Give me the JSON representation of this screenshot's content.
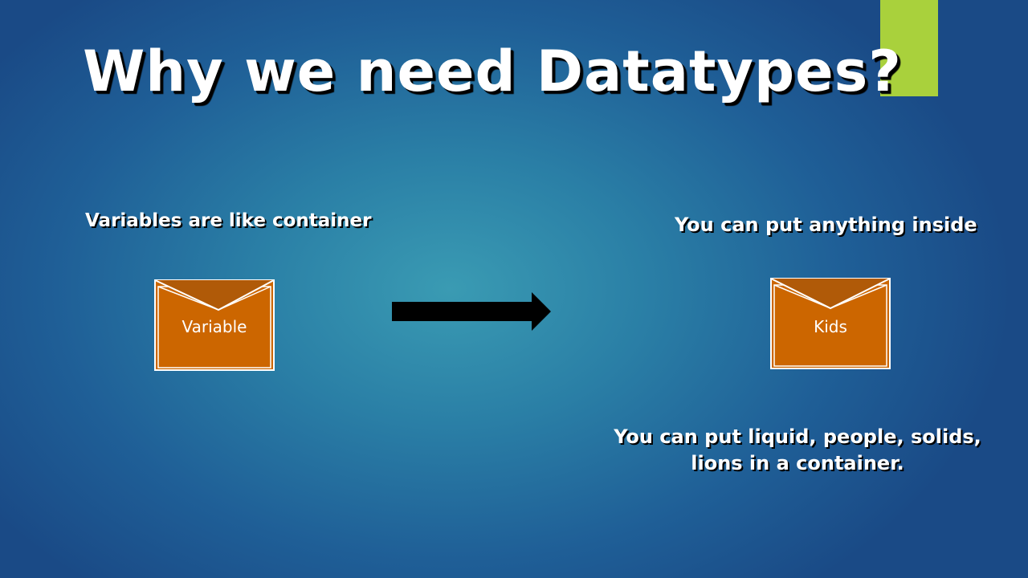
{
  "slide": {
    "title": "Why we need Datatypes?",
    "left_caption": "Variables are like container",
    "right_caption": "You can put anything inside",
    "bottom_caption": "You can put liquid, people, solids, lions in a container.",
    "left_envelope_label": "Variable",
    "right_envelope_label": "Kids"
  },
  "colors": {
    "accent": "#a9d13c",
    "envelope_fill": "#cc6600",
    "envelope_flap": "#b05a08"
  }
}
